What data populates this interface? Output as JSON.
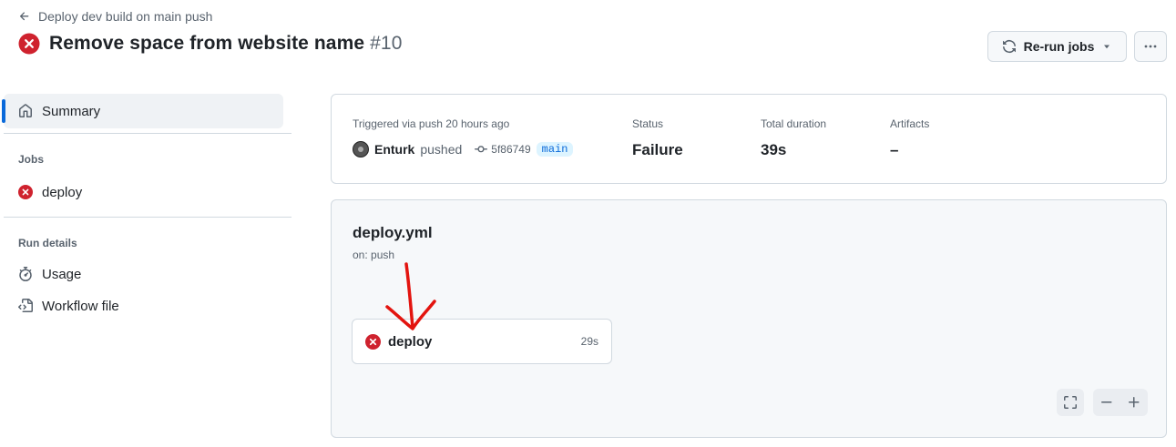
{
  "header": {
    "back_label": "Deploy dev build on main push",
    "title": "Remove space from website name",
    "run_number": "#10",
    "rerun_label": "Re-run jobs"
  },
  "sidebar": {
    "summary_label": "Summary",
    "jobs_heading": "Jobs",
    "jobs": [
      {
        "label": "deploy",
        "status": "failure"
      }
    ],
    "run_details_heading": "Run details",
    "details": [
      {
        "label": "Usage",
        "icon": "stopwatch-icon"
      },
      {
        "label": "Workflow file",
        "icon": "file-code-icon"
      }
    ]
  },
  "summary": {
    "trigger_text": "Triggered via push 20 hours ago",
    "actor": "Enturk",
    "action": "pushed",
    "commit": "5f86749",
    "branch": "main",
    "status_label": "Status",
    "status_value": "Failure",
    "duration_label": "Total duration",
    "duration_value": "39s",
    "artifacts_label": "Artifacts",
    "artifacts_value": "–"
  },
  "workflow": {
    "file": "deploy.yml",
    "trigger": "on: push",
    "job": {
      "name": "deploy",
      "duration": "29s",
      "status": "failure"
    }
  },
  "colors": {
    "failure": "#cf222e",
    "accent": "#0969da",
    "annotation": "#e3140f"
  }
}
